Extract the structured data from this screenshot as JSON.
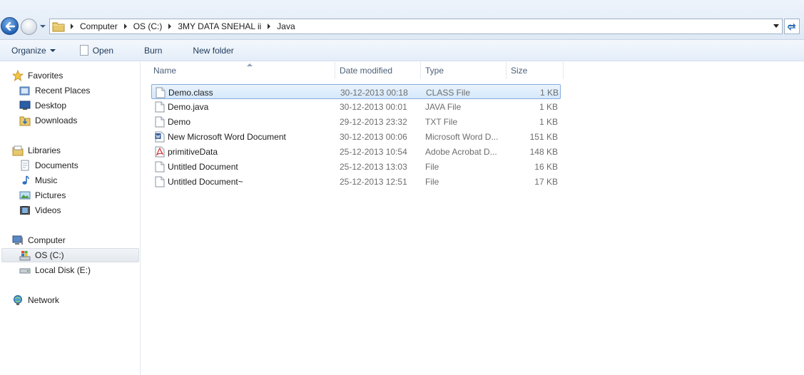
{
  "address_bar": {
    "breadcrumbs": [
      "Computer",
      "OS (C:)",
      "3MY DATA SNEHAL ii",
      "Java"
    ]
  },
  "toolbar": {
    "organize_label": "Organize",
    "open_label": "Open",
    "burn_label": "Burn",
    "new_folder_label": "New folder"
  },
  "sidebar": {
    "favorites": {
      "label": "Favorites",
      "items": [
        "Recent Places",
        "Desktop",
        "Downloads"
      ]
    },
    "libraries": {
      "label": "Libraries",
      "items": [
        "Documents",
        "Music",
        "Pictures",
        "Videos"
      ]
    },
    "computer": {
      "label": "Computer",
      "items": [
        "OS (C:)",
        "Local Disk (E:)"
      ],
      "selected": "OS (C:)"
    },
    "network": {
      "label": "Network"
    }
  },
  "file_list": {
    "columns": [
      "Name",
      "Date modified",
      "Type",
      "Size"
    ],
    "sorted_by": "Name",
    "selected_row": 0,
    "rows": [
      {
        "name": "Demo.class",
        "date": "30-12-2013 00:18",
        "type": "CLASS File",
        "size": "1 KB",
        "icon": "blank-file-icon"
      },
      {
        "name": "Demo.java",
        "date": "30-12-2013 00:01",
        "type": "JAVA File",
        "size": "1 KB",
        "icon": "blank-file-icon"
      },
      {
        "name": "Demo",
        "date": "29-12-2013 23:32",
        "type": "TXT File",
        "size": "1 KB",
        "icon": "blank-file-icon"
      },
      {
        "name": "New Microsoft Word Document",
        "date": "30-12-2013 00:06",
        "type": "Microsoft Word D...",
        "size": "151 KB",
        "icon": "word-document-icon"
      },
      {
        "name": "primitiveData",
        "date": "25-12-2013 10:54",
        "type": "Adobe Acrobat D...",
        "size": "148 KB",
        "icon": "pdf-document-icon"
      },
      {
        "name": "Untitled Document",
        "date": "25-12-2013 13:03",
        "type": "File",
        "size": "16 KB",
        "icon": "blank-file-icon"
      },
      {
        "name": "Untitled Document~",
        "date": "25-12-2013 12:51",
        "type": "File",
        "size": "17 KB",
        "icon": "blank-file-icon"
      }
    ]
  },
  "colors": {
    "selection_border": "#84acdd",
    "toolbar_text": "#1e395b",
    "secondary_text": "#6d6d6d"
  }
}
